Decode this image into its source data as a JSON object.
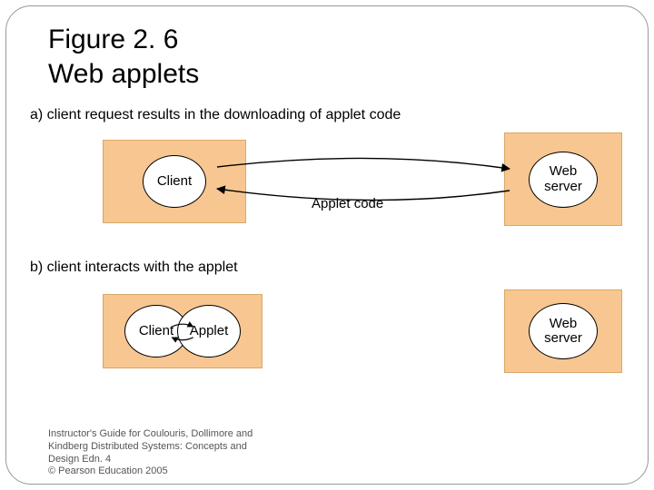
{
  "title_line1": "Figure 2. 6",
  "title_line2": "Web applets",
  "caption_a": "a) client request results in the downloading of applet code",
  "caption_b": "b) client  interacts with the applet",
  "labels": {
    "client": "Client",
    "web_server": "Web\nserver",
    "applet": "Applet",
    "applet_code": "Applet code"
  },
  "footer": {
    "line1": "Instructor's Guide for  Coulouris, Dollimore and",
    "line2": "Kindberg   Distributed Systems: Concepts and",
    "line3": "Design   Edn. 4",
    "line4": "©  Pearson Education 2005"
  }
}
